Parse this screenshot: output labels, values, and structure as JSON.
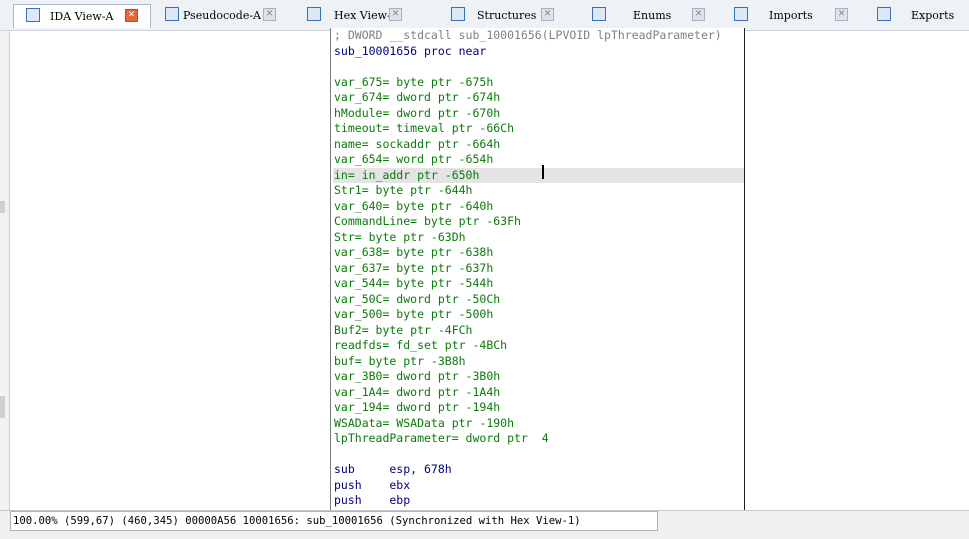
{
  "tabs": [
    {
      "label": "IDA View-A",
      "icon": "disassembly-icon",
      "active": true
    },
    {
      "label": "Pseudocode-A",
      "icon": "pseudocode-icon",
      "active": false
    },
    {
      "label": "Hex View-1",
      "icon": "hex-icon",
      "active": false
    },
    {
      "label": "Structures",
      "icon": "structures-icon",
      "active": false
    },
    {
      "label": "Enums",
      "icon": "enums-icon",
      "active": false
    },
    {
      "label": "Imports",
      "icon": "imports-icon",
      "active": false
    },
    {
      "label": "Exports",
      "icon": "exports-icon",
      "active": false
    }
  ],
  "disasm": {
    "lines": [
      "; DWORD __stdcall sub_10001656(LPVOID lpThreadParameter)",
      "sub_10001656 proc near",
      "",
      "var_675= byte ptr -675h",
      "var_674= dword ptr -674h",
      "hModule= dword ptr -670h",
      "timeout= timeval ptr -66Ch",
      "name= sockaddr ptr -664h",
      "var_654= word ptr -654h",
      "in= in_addr ptr -650h",
      "Str1= byte ptr -644h",
      "var_640= byte ptr -640h",
      "CommandLine= byte ptr -63Fh",
      "Str= byte ptr -63Dh",
      "var_638= byte ptr -638h",
      "var_637= byte ptr -637h",
      "var_544= byte ptr -544h",
      "var_50C= dword ptr -50Ch",
      "var_500= byte ptr -500h",
      "Buf2= byte ptr -4FCh",
      "readfds= fd_set ptr -4BCh",
      "buf= byte ptr -3B8h",
      "var_3B0= dword ptr -3B0h",
      "var_1A4= dword ptr -1A4h",
      "var_194= dword ptr -194h",
      "WSAData= WSAData ptr -190h",
      "lpThreadParameter= dword ptr  4",
      "",
      "sub     esp, 678h",
      "push    ebx",
      "push    ebp"
    ]
  },
  "status": {
    "text": "100.00% (599,67) (460,345) 00000A56 10001656: sub_10001656 (Synchronized with Hex View-1)"
  }
}
